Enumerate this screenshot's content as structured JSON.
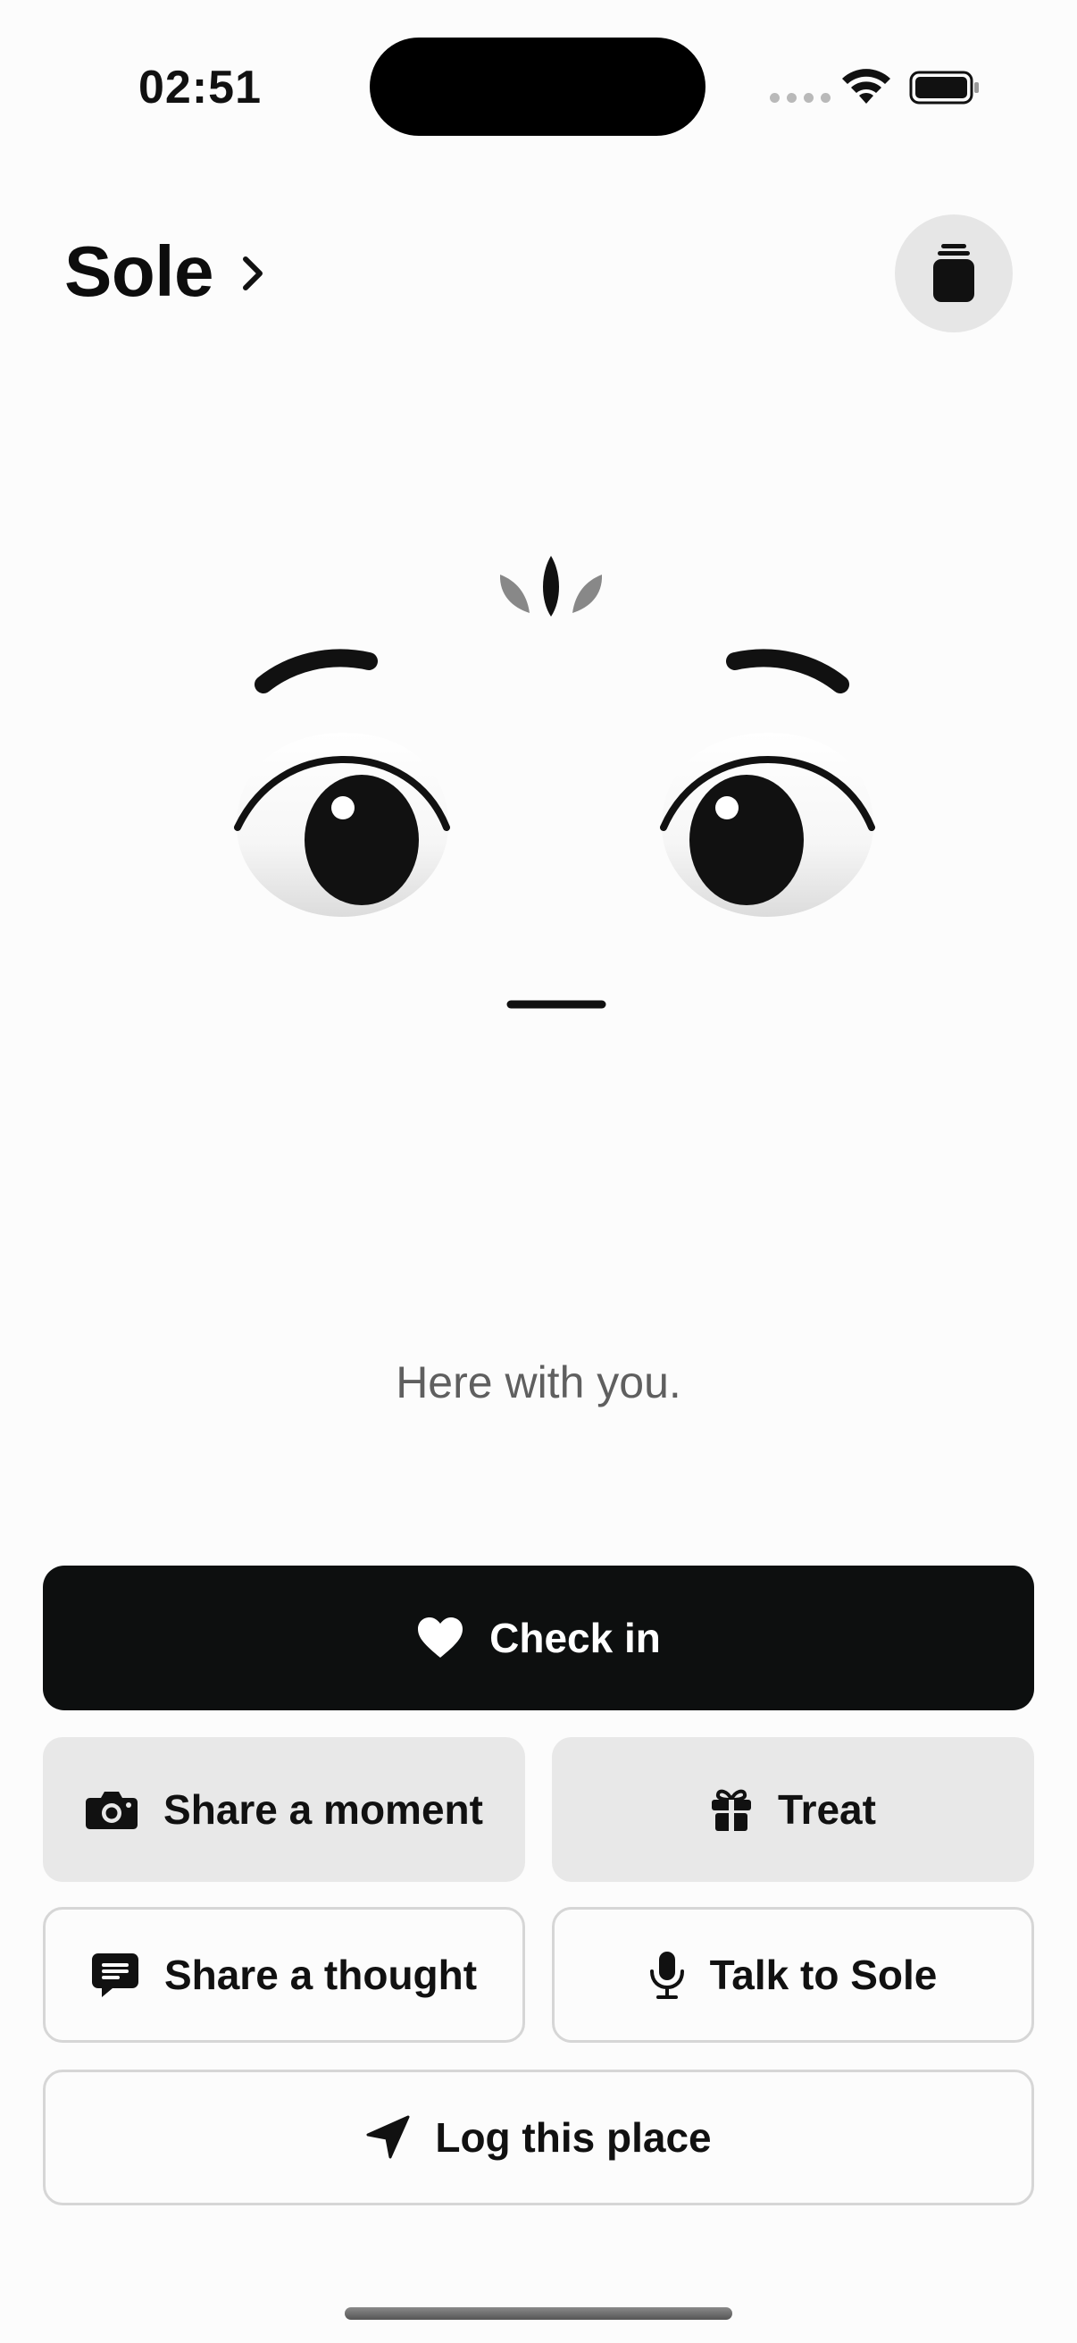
{
  "status_bar": {
    "time": "02:51",
    "icons": [
      "signal-dots-icon",
      "wifi-icon",
      "battery-icon"
    ]
  },
  "header": {
    "title": "Sole",
    "title_chevron_icon": "chevron-right-icon",
    "jar_button_icon": "jar-icon"
  },
  "companion": {
    "tagline": "Here with you."
  },
  "actions": {
    "check_in": {
      "label": "Check in",
      "icon": "heart-icon"
    },
    "share_moment": {
      "label": "Share a moment",
      "icon": "camera-icon"
    },
    "treat": {
      "label": "Treat",
      "icon": "gift-icon"
    },
    "share_thought": {
      "label": "Share a thought",
      "icon": "message-icon"
    },
    "talk": {
      "label": "Talk to Sole",
      "icon": "microphone-icon"
    },
    "log_place": {
      "label": "Log this place",
      "icon": "location-arrow-icon"
    }
  },
  "colors": {
    "primary_button": "#0d0f0f",
    "secondary_button": "#e8e8e8",
    "background": "#fcfcfc",
    "tagline": "#5f5f5f"
  }
}
